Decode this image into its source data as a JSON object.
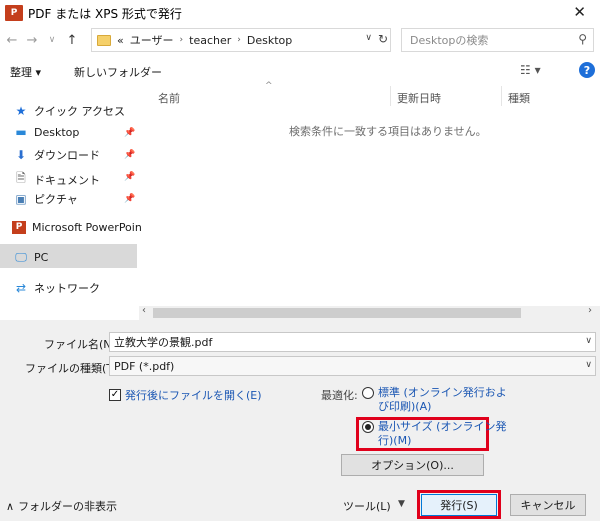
{
  "window": {
    "app_badge": "P",
    "title": "PDF または XPS 形式で発行",
    "close": "✕"
  },
  "nav": {
    "back": "←",
    "forward": "→",
    "recent": "∨",
    "up": "↑",
    "crumbs": [
      "«",
      "ユーザー",
      "teacher",
      "Desktop"
    ],
    "search_placeholder": "Desktopの検索"
  },
  "toolbar": {
    "organize": "整理 ▾",
    "new_folder": "新しいフォルダー"
  },
  "navpane": {
    "quick_access": "クイック アクセス",
    "desktop": "Desktop",
    "downloads": "ダウンロード",
    "documents": "ドキュメント",
    "pictures": "ピクチャ",
    "powerpoint": "Microsoft PowerPoin",
    "pc": "PC",
    "network": "ネットワーク"
  },
  "list": {
    "col_name": "名前",
    "col_modified": "更新日時",
    "col_type": "種類",
    "empty": "検索条件に一致する項目はありません。"
  },
  "form": {
    "filename_label": "ファイル名(N):",
    "filename_value": "立教大学の景観.pdf",
    "filetype_label": "ファイルの種類(T):",
    "filetype_value": "PDF (*.pdf)",
    "open_after": "発行後にファイルを開く(E)",
    "optimize_label": "最適化:",
    "opt_standard": [
      "標準 (オンライン発行およ",
      "び印刷)(A)"
    ],
    "opt_minimum": [
      "最小サイズ (オンライン発",
      "行)(M)"
    ],
    "options_button": "オプション(O)...",
    "hide_folders": "フォルダーの非表示",
    "tools": "ツール(L)",
    "publish": "発行(S)",
    "cancel": "キャンセル"
  },
  "colors": {
    "highlight": "#e0001b",
    "link": "#1a56b3",
    "selected": "#d9d9d9"
  }
}
